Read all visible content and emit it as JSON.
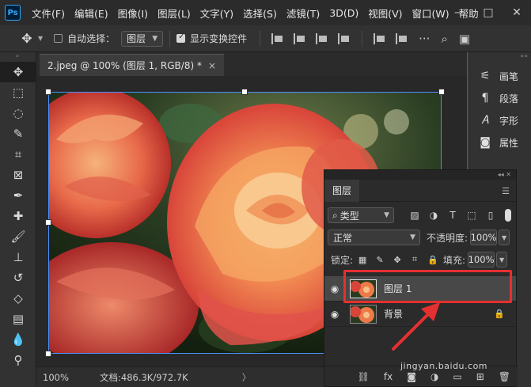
{
  "app": {
    "logo": "Ps",
    "menus": [
      "文件(F)",
      "编辑(E)",
      "图像(I)",
      "图层(L)",
      "文字(Y)",
      "选择(S)",
      "滤镜(T)",
      "3D(D)",
      "视图(V)",
      "窗口(W)",
      "帮助"
    ],
    "window_controls": [
      "—",
      "□",
      "✕"
    ]
  },
  "options": {
    "auto_select_label": "自动选择：",
    "auto_select_target": "图层",
    "show_transform_label": "显示变换控件"
  },
  "document": {
    "tab_title": "2.jpeg @ 100% (图层 1, RGB/8) *",
    "close": "×"
  },
  "status": {
    "zoom": "100%",
    "doc_size": "文档:486.3K/972.7K",
    "caret": "〉"
  },
  "right_dock": {
    "items": [
      "画笔",
      "段落",
      "字形",
      "属性"
    ]
  },
  "layers_panel": {
    "tab": "图层",
    "filter_kind": "类型",
    "blend_mode": "正常",
    "opacity_label": "不透明度:",
    "opacity_value": "100%",
    "lock_label": "锁定:",
    "fill_label": "填充:",
    "fill_value": "100%",
    "layers": [
      {
        "name": "图层 1",
        "selected": true,
        "locked": false
      },
      {
        "name": "背景",
        "selected": false,
        "locked": true
      }
    ]
  },
  "watermark": "jingyan.baidu.com",
  "colors": {
    "accent_blue": "#4a90ff",
    "highlight_red": "#e53030"
  }
}
